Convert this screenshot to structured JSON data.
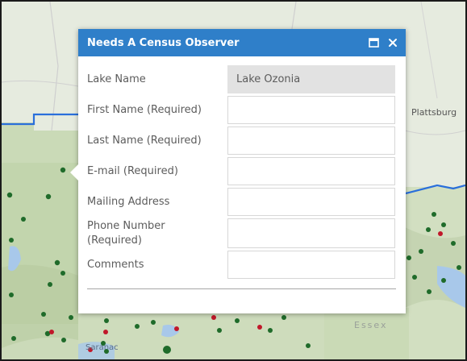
{
  "popup": {
    "title": "Needs A Census Observer",
    "maximize_icon": "maximize-icon",
    "close_icon": "close-icon",
    "header_color": "#2f7fc9"
  },
  "form": {
    "fields": [
      {
        "label": "Lake Name",
        "value": "Lake Ozonia",
        "readonly": true
      },
      {
        "label": "First Name (Required)",
        "value": ""
      },
      {
        "label": "Last Name (Required)",
        "value": ""
      },
      {
        "label": "E-mail (Required)",
        "value": ""
      },
      {
        "label": "Mailing Address",
        "value": ""
      },
      {
        "label": "Phone Number (Required)",
        "value": ""
      },
      {
        "label": "Comments",
        "value": ""
      }
    ]
  },
  "map": {
    "labels": {
      "plattsburgh": "Plattsburg",
      "essex": "Essex",
      "saranac": "Saranac"
    },
    "colors": {
      "boundary": "#2a6fdb",
      "forest": "#c9d9b4",
      "water": "#a8c8ea",
      "dot_green": "#1f6b2a",
      "dot_red": "#c0182a"
    }
  }
}
